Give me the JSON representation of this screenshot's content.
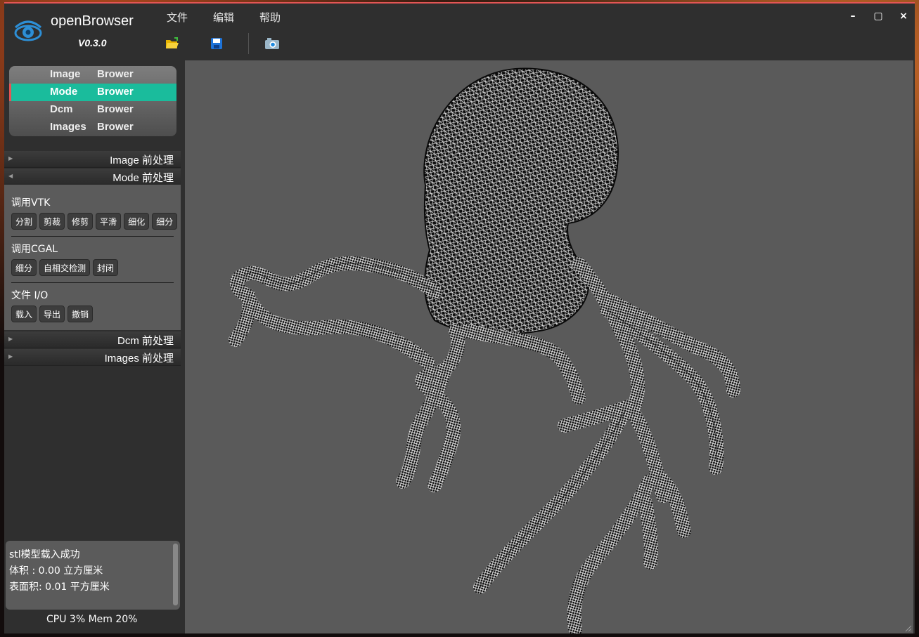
{
  "app": {
    "name": "openBrowser",
    "version": "V0.3.0"
  },
  "menu": {
    "items": [
      "文件",
      "编辑",
      "帮助"
    ]
  },
  "toolbar": {
    "icons": [
      "open-folder-icon",
      "save-disk-icon",
      "camera-icon"
    ]
  },
  "window_controls": {
    "minimize": "–",
    "maximize": "▢",
    "close": "×"
  },
  "nav": {
    "items": [
      {
        "word1": "Image",
        "word2": "Brower",
        "active": false
      },
      {
        "word1": "Mode",
        "word2": "Brower",
        "active": true
      },
      {
        "word1": "Dcm",
        "word2": "Brower",
        "active": false
      },
      {
        "word1": "Images",
        "word2": "Brower",
        "active": false
      }
    ]
  },
  "sections": {
    "image": "Image  前处理",
    "mode": "Mode  前处理",
    "dcm": "Dcm  前处理",
    "images": "Images  前处理"
  },
  "mode_panel": {
    "vtk_label": "调用VTK",
    "vtk_buttons": [
      "分割",
      "剪裁",
      "修剪",
      "平滑",
      "细化",
      "细分"
    ],
    "cgal_label": "调用CGAL",
    "cgal_buttons": [
      "细分",
      "自相交检测",
      "封闭"
    ],
    "io_label": "文件 I/O",
    "io_buttons": [
      "载入",
      "导出",
      "撤销"
    ]
  },
  "log": {
    "line1": "stl模型载入成功",
    "line2": "体积 : 0.00 立方厘米",
    "line3": "表面积: 0.01 平方厘米"
  },
  "status": {
    "text": "CPU 3%  Mem 20%"
  },
  "colors": {
    "accent": "#1abc9c",
    "window_border": "#e45555",
    "panel": "#5b5b5b",
    "viewport": "#5a5a5a"
  }
}
